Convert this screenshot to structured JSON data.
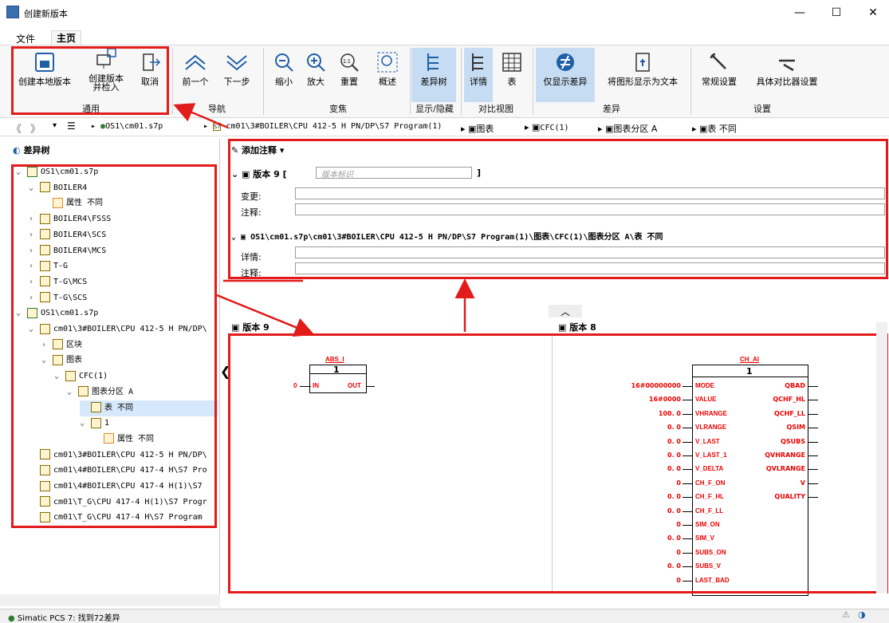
{
  "window": {
    "title": "创建新版本",
    "minimize": "—",
    "maximize": "☐",
    "close": "✕"
  },
  "menu": {
    "file": "文件",
    "home": "主页"
  },
  "ribbon": {
    "create_local": "创建本地版本",
    "create_checkin": "创建版本\n并检入",
    "cancel": "取消",
    "group_general": "通用",
    "prev": "前一个",
    "next": "下一步",
    "group_nav": "导航",
    "zoom_out": "缩小",
    "zoom_in": "放大",
    "reset": "重置",
    "overview": "概述",
    "group_zoom": "变焦",
    "diff_tree": "差异树",
    "group_showhide": "显示/隐藏",
    "details": "详情",
    "table": "表",
    "group_compare": "对比视图",
    "only_diff": "仅显示差异",
    "graphic_as_text": "将图形显示为文本",
    "group_diff": "差异",
    "general_settings": "常规设置",
    "specific_settings": "具体对比器设置",
    "group_settings": "设置"
  },
  "breadcrumb": {
    "root": "OS1\\cm01.s7p",
    "program": "cm01\\3#BOILER\\CPU 412-5 H PN/DP\\S7 Program(1)",
    "charts": "图表",
    "cfc": "CFC(1)",
    "partition": "图表分区 A",
    "table": "表 不同"
  },
  "diff_tree": {
    "title": "差异树",
    "rows": [
      "OS1\\cm01.s7p",
      "BOILER4",
      "属性 不同",
      "BOILER4\\FSSS",
      "BOILER4\\SCS",
      "BOILER4\\MCS",
      "T-G",
      "T-G\\MCS",
      "T-G\\SCS",
      "OS1\\cm01.s7p",
      "cm01\\3#BOILER\\CPU 412-5 H PN/DP\\",
      "区块",
      "图表",
      "CFC(1)",
      "图表分区 A",
      "表 不同",
      "1",
      "属性 不同",
      "cm01\\3#BOILER\\CPU 412-5 H PN/DP\\",
      "cm01\\4#BOILER\\CPU 417-4 H\\S7 Pro",
      "cm01\\4#BOILER\\CPU 417-4 H(1)\\S7",
      "cm01\\T_G\\CPU 417-4 H(1)\\S7 Progr",
      "cm01\\T_G\\CPU 417-4 H\\S7 Program"
    ]
  },
  "annotation": {
    "add": "添加注释",
    "version_label": "版本",
    "version_num": "9",
    "open_bracket": "[",
    "close_bracket": "]",
    "version_placeholder": "版本标识",
    "change": "变更:",
    "comment": "注释:",
    "path": "OS1\\cm01.s7p\\cm01\\3#BOILER\\CPU 412-5 H PN/DP\\S7 Program(1)\\图表\\CFC(1)\\图表分区 A\\表 不同",
    "detail": "详情:",
    "comment2": "注释:"
  },
  "left_view": {
    "header": "版本 9",
    "block_name": "ABS_I",
    "block_num": "1",
    "in_val": "0",
    "in": "IN",
    "out": "OUT"
  },
  "right_view": {
    "header": "版本 8",
    "block_name": "CH_AI",
    "block_num": "1",
    "inputs": [
      [
        "16#00000000",
        "MODE"
      ],
      [
        "16#0000",
        "VALUE"
      ],
      [
        "100. 0",
        "VHRANGE"
      ],
      [
        "0. 0",
        "VLRANGE"
      ],
      [
        "0. 0",
        "V_LAST"
      ],
      [
        "0. 0",
        "V_LAST_1"
      ],
      [
        "0. 0",
        "V_DELTA"
      ],
      [
        "0",
        "CH_F_ON"
      ],
      [
        "0. 0",
        "CH_F_HL"
      ],
      [
        "0. 0",
        "CH_F_LL"
      ],
      [
        "0",
        "SIM_ON"
      ],
      [
        "0. 0",
        "SIM_V"
      ],
      [
        "0",
        "SUBS_ON"
      ],
      [
        "0. 0",
        "SUBS_V"
      ],
      [
        "0",
        "LAST_BAD"
      ]
    ],
    "outputs": [
      "QBAD",
      "QCHF_HL",
      "QCHF_LL",
      "QSIM",
      "QSUBS",
      "QVHRANGE",
      "QVLRANGE",
      "V",
      "QUALITY"
    ]
  },
  "status": {
    "text": "Simatic PCS 7: 找到72差异"
  }
}
